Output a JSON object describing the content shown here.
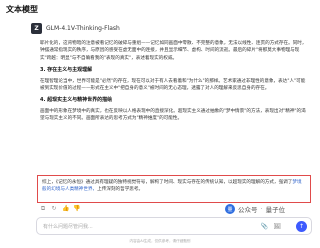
{
  "app": {
    "title": "文本模型"
  },
  "model": {
    "logo_text": "Z",
    "name": "GLM-4.1V-Thinking-Flash"
  },
  "content": {
    "p1": "耶片化的，这背物暗的注意被看记忆的破碎与重组——记忆如同画面中零散、不完整的意象，无法以线性、连贯的方式存在。同时，钟摆通常指现实的秩序，与原因的感受在虚无面中的连接，并且显示细节、虚构、时间的流逝。最后的碎片\"将那莫大事物理与现实\"跨越：明显\"与不自确看我的\"表现的真实\"，表述着现实的权威。",
    "s2_title": "3. 存在主义与主观理解",
    "s2_body": "在理智理论当中，世界可能是\"必然\"的存在，现在可以对于有人去看着和\"为什么\"的那样。艺术家通过非理性的意象，表达\"人\"可能被到实现价值的过程——形式在主义中\"把自身的意义\"被时间的无心态理，透露了对人的理解来反思自身的存在。",
    "s3_title": "4. 超现实主义与精神世界的描绘",
    "s3_body": "画面中的形象在梦境中的真实，也在反映以人格表现中的直接深化。超现实主义通过抽象的\"梦中情景\"的方法，表现出对\"精神\"的渴望与现实主义的不同。画面所表达的思考方式为\"精神维度\"的可能性。"
  },
  "summary": {
    "text_before": "综上，《记忆的永恒》通过具有理疑的独特视觉符号，解构了时间、现实与存在的传统认知，以超现实的理解的方式，强调了",
    "highlight": "梦境般的幻境与人类精神世界，",
    "text_after": "上传深刻的哲学思考。"
  },
  "actions": {
    "copy": "⧉",
    "refresh": "↻",
    "like": "👍",
    "dislike": "👎"
  },
  "input": {
    "placeholder": "有什么问题尽管问我...",
    "attach_icon": "📎",
    "image_icon": "🖼",
    "send_icon": "↑"
  },
  "footer": {
    "note": "内容由AI生成，仅供参考，请仔细甄别"
  },
  "watermark": {
    "logo_text": "量",
    "prefix": "公众号",
    "dot": "·",
    "name": "量子位"
  }
}
